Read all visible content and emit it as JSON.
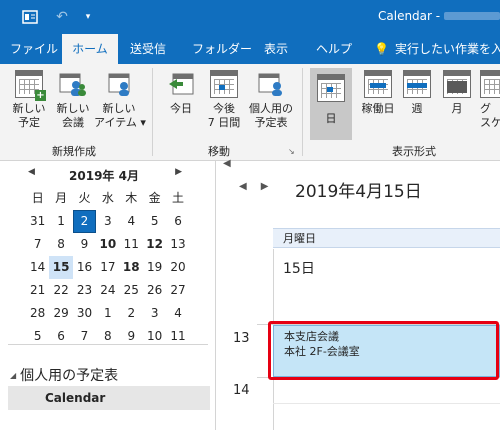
{
  "titlebar": {
    "title": "Calendar - ",
    "icons": [
      "outlook-app-icon",
      "undo-icon",
      "customize-qa-icon"
    ]
  },
  "tabs": [
    {
      "label": "ファイル"
    },
    {
      "label": "ホーム",
      "active": true
    },
    {
      "label": "送受信"
    },
    {
      "label": "フォルダー"
    },
    {
      "label": "表示"
    },
    {
      "label": "ヘルプ"
    },
    {
      "label": "実行したい作業を入"
    }
  ],
  "ribbon": {
    "new_group": {
      "label": "新規作成",
      "buttons": [
        {
          "line1": "新しい",
          "line2": "予定"
        },
        {
          "line1": "新しい",
          "line2": "会議"
        },
        {
          "line1": "新しい",
          "line2": "アイテム ▾"
        }
      ]
    },
    "goto_group": {
      "label": "移動",
      "buttons": [
        {
          "line1": "今日",
          "line2": ""
        },
        {
          "line1": "今後",
          "line2": "7 日間"
        },
        {
          "line1": "個人用の",
          "line2": "予定表"
        }
      ]
    },
    "view_group": {
      "label": "表示形式",
      "buttons": [
        {
          "line1": "日",
          "line2": ""
        },
        {
          "line1": "稼働日",
          "line2": ""
        },
        {
          "line1": "週",
          "line2": ""
        },
        {
          "line1": "月",
          "line2": ""
        },
        {
          "line1": "グ",
          "line2": "スケ"
        }
      ]
    }
  },
  "mini_calendar": {
    "month_title": "2019年 4月",
    "weekday_headers": [
      "日",
      "月",
      "火",
      "水",
      "木",
      "金",
      "土"
    ],
    "weeks": [
      [
        "31",
        "1",
        "2",
        "3",
        "4",
        "5",
        "6"
      ],
      [
        "7",
        "8",
        "9",
        "10",
        "11",
        "12",
        "13"
      ],
      [
        "14",
        "15",
        "16",
        "17",
        "18",
        "19",
        "20"
      ],
      [
        "21",
        "22",
        "23",
        "24",
        "25",
        "26",
        "27"
      ],
      [
        "28",
        "29",
        "30",
        "1",
        "2",
        "3",
        "4"
      ],
      [
        "5",
        "6",
        "7",
        "8",
        "9",
        "10",
        "11"
      ]
    ],
    "bold_days": [
      "10",
      "12",
      "18"
    ],
    "selected_day": "2",
    "today_day": "15"
  },
  "folders": {
    "section_label": "個人用の予定表",
    "items": [
      {
        "label": "Calendar"
      }
    ]
  },
  "day_view": {
    "date_title": "2019年4月15日",
    "weekday": "月曜日",
    "day_number": "15日",
    "hours": [
      "13",
      "14"
    ]
  },
  "appointment": {
    "subject": "本支店会議",
    "location": "本社 2F-会議室"
  },
  "colors": {
    "brand": "#106ebe",
    "appointment_bg": "#c5e5f7",
    "highlight": "#e60012",
    "selected_day": "#106ebe",
    "today_bg": "#cfe3f7"
  }
}
